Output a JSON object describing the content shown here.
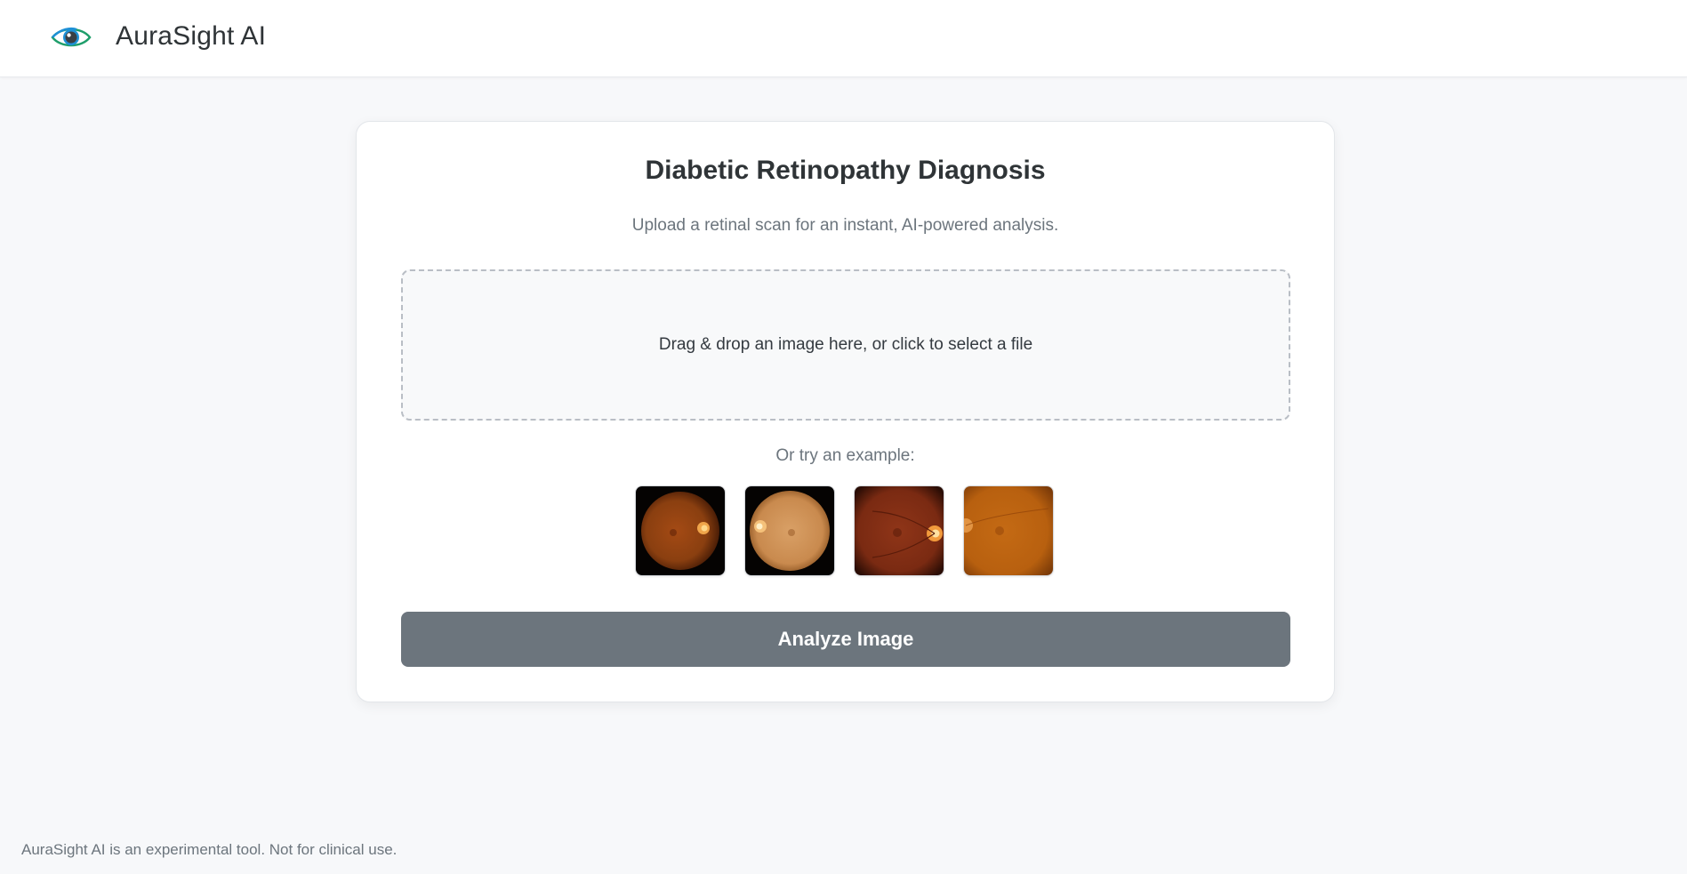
{
  "header": {
    "brand": "AuraSight AI",
    "logo_icon": "eye-icon"
  },
  "card": {
    "title": "Diabetic Retinopathy Diagnosis",
    "subtitle": "Upload a retinal scan for an instant, AI-powered analysis.",
    "dropzone_text": "Drag & drop an image here, or click to select a file",
    "examples_label": "Or try an example:",
    "examples": [
      {
        "name": "example-retina-1",
        "tone": "#8a3f10"
      },
      {
        "name": "example-retina-2",
        "tone": "#c98a4e"
      },
      {
        "name": "example-retina-3",
        "tone": "#7a2a12"
      },
      {
        "name": "example-retina-4",
        "tone": "#b8600f"
      }
    ],
    "analyze_label": "Analyze Image"
  },
  "footer": {
    "disclaimer": "AuraSight AI is an experimental tool. Not for clinical use."
  },
  "colors": {
    "accent_green": "#1f9e6b",
    "accent_blue": "#1e90d6",
    "button_gray": "#6c757d",
    "page_bg": "#f7f8fa"
  }
}
